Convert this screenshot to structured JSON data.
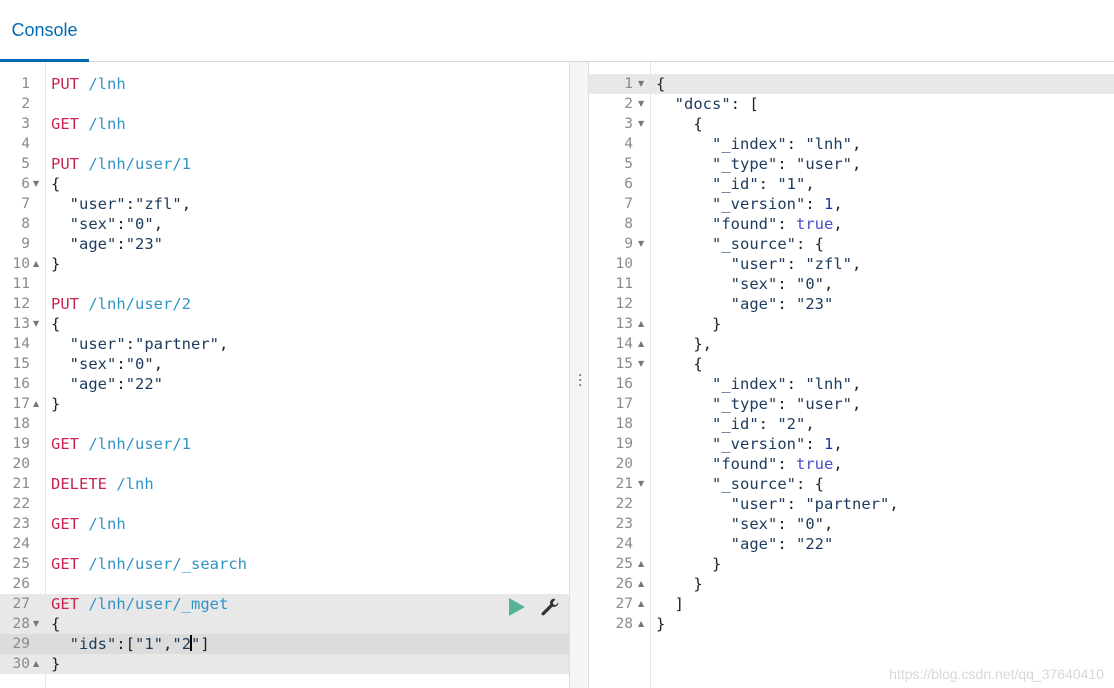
{
  "header": {
    "tab_console": "Console"
  },
  "request_editor": {
    "lines": [
      {
        "n": "1",
        "fold": "",
        "parts": [
          [
            "m",
            "PUT"
          ],
          [
            "p",
            " "
          ],
          [
            "u",
            "/lnh"
          ]
        ]
      },
      {
        "n": "2",
        "fold": "",
        "parts": []
      },
      {
        "n": "3",
        "fold": "",
        "parts": [
          [
            "m",
            "GET"
          ],
          [
            "p",
            " "
          ],
          [
            "u",
            "/lnh"
          ]
        ]
      },
      {
        "n": "4",
        "fold": "",
        "parts": []
      },
      {
        "n": "5",
        "fold": "",
        "parts": [
          [
            "m",
            "PUT"
          ],
          [
            "p",
            " "
          ],
          [
            "u",
            "/lnh/user/1"
          ]
        ]
      },
      {
        "n": "6",
        "fold": "▼",
        "parts": [
          [
            "p",
            "{"
          ]
        ]
      },
      {
        "n": "7",
        "fold": "",
        "parts": [
          [
            "p",
            "  "
          ],
          [
            "s",
            "\"user\""
          ],
          [
            "p",
            ":"
          ],
          [
            "s",
            "\"zfl\""
          ],
          [
            "p",
            ","
          ]
        ]
      },
      {
        "n": "8",
        "fold": "",
        "parts": [
          [
            "p",
            "  "
          ],
          [
            "s",
            "\"sex\""
          ],
          [
            "p",
            ":"
          ],
          [
            "s",
            "\"0\""
          ],
          [
            "p",
            ","
          ]
        ]
      },
      {
        "n": "9",
        "fold": "",
        "parts": [
          [
            "p",
            "  "
          ],
          [
            "s",
            "\"age\""
          ],
          [
            "p",
            ":"
          ],
          [
            "s",
            "\"23\""
          ]
        ]
      },
      {
        "n": "10",
        "fold": "▲",
        "parts": [
          [
            "p",
            "}"
          ]
        ]
      },
      {
        "n": "11",
        "fold": "",
        "parts": []
      },
      {
        "n": "12",
        "fold": "",
        "parts": [
          [
            "m",
            "PUT"
          ],
          [
            "p",
            " "
          ],
          [
            "u",
            "/lnh/user/2"
          ]
        ]
      },
      {
        "n": "13",
        "fold": "▼",
        "parts": [
          [
            "p",
            "{"
          ]
        ]
      },
      {
        "n": "14",
        "fold": "",
        "parts": [
          [
            "p",
            "  "
          ],
          [
            "s",
            "\"user\""
          ],
          [
            "p",
            ":"
          ],
          [
            "s",
            "\"partner\""
          ],
          [
            "p",
            ","
          ]
        ]
      },
      {
        "n": "15",
        "fold": "",
        "parts": [
          [
            "p",
            "  "
          ],
          [
            "s",
            "\"sex\""
          ],
          [
            "p",
            ":"
          ],
          [
            "s",
            "\"0\""
          ],
          [
            "p",
            ","
          ]
        ]
      },
      {
        "n": "16",
        "fold": "",
        "parts": [
          [
            "p",
            "  "
          ],
          [
            "s",
            "\"age\""
          ],
          [
            "p",
            ":"
          ],
          [
            "s",
            "\"22\""
          ]
        ]
      },
      {
        "n": "17",
        "fold": "▲",
        "parts": [
          [
            "p",
            "}"
          ]
        ]
      },
      {
        "n": "18",
        "fold": "",
        "parts": []
      },
      {
        "n": "19",
        "fold": "",
        "parts": [
          [
            "m",
            "GET"
          ],
          [
            "p",
            " "
          ],
          [
            "u",
            "/lnh/user/1"
          ]
        ]
      },
      {
        "n": "20",
        "fold": "",
        "parts": []
      },
      {
        "n": "21",
        "fold": "",
        "parts": [
          [
            "m",
            "DELETE"
          ],
          [
            "p",
            " "
          ],
          [
            "u",
            "/lnh"
          ]
        ]
      },
      {
        "n": "22",
        "fold": "",
        "parts": []
      },
      {
        "n": "23",
        "fold": "",
        "parts": [
          [
            "m",
            "GET"
          ],
          [
            "p",
            " "
          ],
          [
            "u",
            "/lnh"
          ]
        ]
      },
      {
        "n": "24",
        "fold": "",
        "parts": []
      },
      {
        "n": "25",
        "fold": "",
        "parts": [
          [
            "m",
            "GET"
          ],
          [
            "p",
            " "
          ],
          [
            "u",
            "/lnh/user/_search"
          ]
        ]
      },
      {
        "n": "26",
        "fold": "",
        "parts": []
      },
      {
        "n": "27",
        "fold": "",
        "hl": "hl",
        "parts": [
          [
            "m",
            "GET"
          ],
          [
            "p",
            " "
          ],
          [
            "u",
            "/lnh/user/_mget"
          ]
        ]
      },
      {
        "n": "28",
        "fold": "▼",
        "hl": "hl",
        "parts": [
          [
            "p",
            "{"
          ]
        ]
      },
      {
        "n": "29",
        "fold": "",
        "hl": "hl2",
        "cursor": true,
        "parts": [
          [
            "p",
            "  "
          ],
          [
            "s",
            "\"ids\""
          ],
          [
            "p",
            ":["
          ],
          [
            "s",
            "\"1\""
          ],
          [
            "p",
            ","
          ],
          [
            "s",
            "\"2"
          ]
        ],
        "after": [
          [
            "s",
            "\""
          ],
          [
            "p",
            "]"
          ]
        ]
      },
      {
        "n": "30",
        "fold": "▲",
        "hl": "hl",
        "parts": [
          [
            "p",
            "}"
          ]
        ]
      }
    ]
  },
  "response_viewer": {
    "lines": [
      {
        "n": "1",
        "fold": "▼",
        "hl": "hl",
        "parts": [
          [
            "p",
            "{"
          ]
        ]
      },
      {
        "n": "2",
        "fold": "▼",
        "parts": [
          [
            "p",
            "  "
          ],
          [
            "k",
            "\"docs\""
          ],
          [
            "p",
            ": ["
          ]
        ]
      },
      {
        "n": "3",
        "fold": "▼",
        "parts": [
          [
            "p",
            "    {"
          ]
        ]
      },
      {
        "n": "4",
        "fold": "",
        "parts": [
          [
            "p",
            "      "
          ],
          [
            "k",
            "\"_index\""
          ],
          [
            "p",
            ": "
          ],
          [
            "s",
            "\"lnh\""
          ],
          [
            "p",
            ","
          ]
        ]
      },
      {
        "n": "5",
        "fold": "",
        "parts": [
          [
            "p",
            "      "
          ],
          [
            "k",
            "\"_type\""
          ],
          [
            "p",
            ": "
          ],
          [
            "s",
            "\"user\""
          ],
          [
            "p",
            ","
          ]
        ]
      },
      {
        "n": "6",
        "fold": "",
        "parts": [
          [
            "p",
            "      "
          ],
          [
            "k",
            "\"_id\""
          ],
          [
            "p",
            ": "
          ],
          [
            "s",
            "\"1\""
          ],
          [
            "p",
            ","
          ]
        ]
      },
      {
        "n": "7",
        "fold": "",
        "parts": [
          [
            "p",
            "      "
          ],
          [
            "k",
            "\"_version\""
          ],
          [
            "p",
            ": "
          ],
          [
            "n",
            "1"
          ],
          [
            "p",
            ","
          ]
        ]
      },
      {
        "n": "8",
        "fold": "",
        "parts": [
          [
            "p",
            "      "
          ],
          [
            "k",
            "\"found\""
          ],
          [
            "p",
            ": "
          ],
          [
            "b",
            "true"
          ],
          [
            "p",
            ","
          ]
        ]
      },
      {
        "n": "9",
        "fold": "▼",
        "parts": [
          [
            "p",
            "      "
          ],
          [
            "k",
            "\"_source\""
          ],
          [
            "p",
            ": {"
          ]
        ]
      },
      {
        "n": "10",
        "fold": "",
        "parts": [
          [
            "p",
            "        "
          ],
          [
            "k",
            "\"user\""
          ],
          [
            "p",
            ": "
          ],
          [
            "s",
            "\"zfl\""
          ],
          [
            "p",
            ","
          ]
        ]
      },
      {
        "n": "11",
        "fold": "",
        "parts": [
          [
            "p",
            "        "
          ],
          [
            "k",
            "\"sex\""
          ],
          [
            "p",
            ": "
          ],
          [
            "s",
            "\"0\""
          ],
          [
            "p",
            ","
          ]
        ]
      },
      {
        "n": "12",
        "fold": "",
        "parts": [
          [
            "p",
            "        "
          ],
          [
            "k",
            "\"age\""
          ],
          [
            "p",
            ": "
          ],
          [
            "s",
            "\"23\""
          ]
        ]
      },
      {
        "n": "13",
        "fold": "▲",
        "parts": [
          [
            "p",
            "      }"
          ]
        ]
      },
      {
        "n": "14",
        "fold": "▲",
        "parts": [
          [
            "p",
            "    },"
          ]
        ]
      },
      {
        "n": "15",
        "fold": "▼",
        "parts": [
          [
            "p",
            "    {"
          ]
        ]
      },
      {
        "n": "16",
        "fold": "",
        "parts": [
          [
            "p",
            "      "
          ],
          [
            "k",
            "\"_index\""
          ],
          [
            "p",
            ": "
          ],
          [
            "s",
            "\"lnh\""
          ],
          [
            "p",
            ","
          ]
        ]
      },
      {
        "n": "17",
        "fold": "",
        "parts": [
          [
            "p",
            "      "
          ],
          [
            "k",
            "\"_type\""
          ],
          [
            "p",
            ": "
          ],
          [
            "s",
            "\"user\""
          ],
          [
            "p",
            ","
          ]
        ]
      },
      {
        "n": "18",
        "fold": "",
        "parts": [
          [
            "p",
            "      "
          ],
          [
            "k",
            "\"_id\""
          ],
          [
            "p",
            ": "
          ],
          [
            "s",
            "\"2\""
          ],
          [
            "p",
            ","
          ]
        ]
      },
      {
        "n": "19",
        "fold": "",
        "parts": [
          [
            "p",
            "      "
          ],
          [
            "k",
            "\"_version\""
          ],
          [
            "p",
            ": "
          ],
          [
            "n",
            "1"
          ],
          [
            "p",
            ","
          ]
        ]
      },
      {
        "n": "20",
        "fold": "",
        "parts": [
          [
            "p",
            "      "
          ],
          [
            "k",
            "\"found\""
          ],
          [
            "p",
            ": "
          ],
          [
            "b",
            "true"
          ],
          [
            "p",
            ","
          ]
        ]
      },
      {
        "n": "21",
        "fold": "▼",
        "parts": [
          [
            "p",
            "      "
          ],
          [
            "k",
            "\"_source\""
          ],
          [
            "p",
            ": {"
          ]
        ]
      },
      {
        "n": "22",
        "fold": "",
        "parts": [
          [
            "p",
            "        "
          ],
          [
            "k",
            "\"user\""
          ],
          [
            "p",
            ": "
          ],
          [
            "s",
            "\"partner\""
          ],
          [
            "p",
            ","
          ]
        ]
      },
      {
        "n": "23",
        "fold": "",
        "parts": [
          [
            "p",
            "        "
          ],
          [
            "k",
            "\"sex\""
          ],
          [
            "p",
            ": "
          ],
          [
            "s",
            "\"0\""
          ],
          [
            "p",
            ","
          ]
        ]
      },
      {
        "n": "24",
        "fold": "",
        "parts": [
          [
            "p",
            "        "
          ],
          [
            "k",
            "\"age\""
          ],
          [
            "p",
            ": "
          ],
          [
            "s",
            "\"22\""
          ]
        ]
      },
      {
        "n": "25",
        "fold": "▲",
        "parts": [
          [
            "p",
            "      }"
          ]
        ]
      },
      {
        "n": "26",
        "fold": "▲",
        "parts": [
          [
            "p",
            "    }"
          ]
        ]
      },
      {
        "n": "27",
        "fold": "▲",
        "parts": [
          [
            "p",
            "  ]"
          ]
        ]
      },
      {
        "n": "28",
        "fold": "▲",
        "parts": [
          [
            "p",
            "}"
          ]
        ]
      }
    ]
  },
  "actions": {
    "send_icon": "play-icon",
    "settings_icon": "wrench-icon"
  },
  "colors": {
    "accent": "#006bb4",
    "method": "#c7254e",
    "url": "#3194c6",
    "play": "#54b399"
  },
  "watermark": "https://blog.csdn.net/qq_37640410"
}
